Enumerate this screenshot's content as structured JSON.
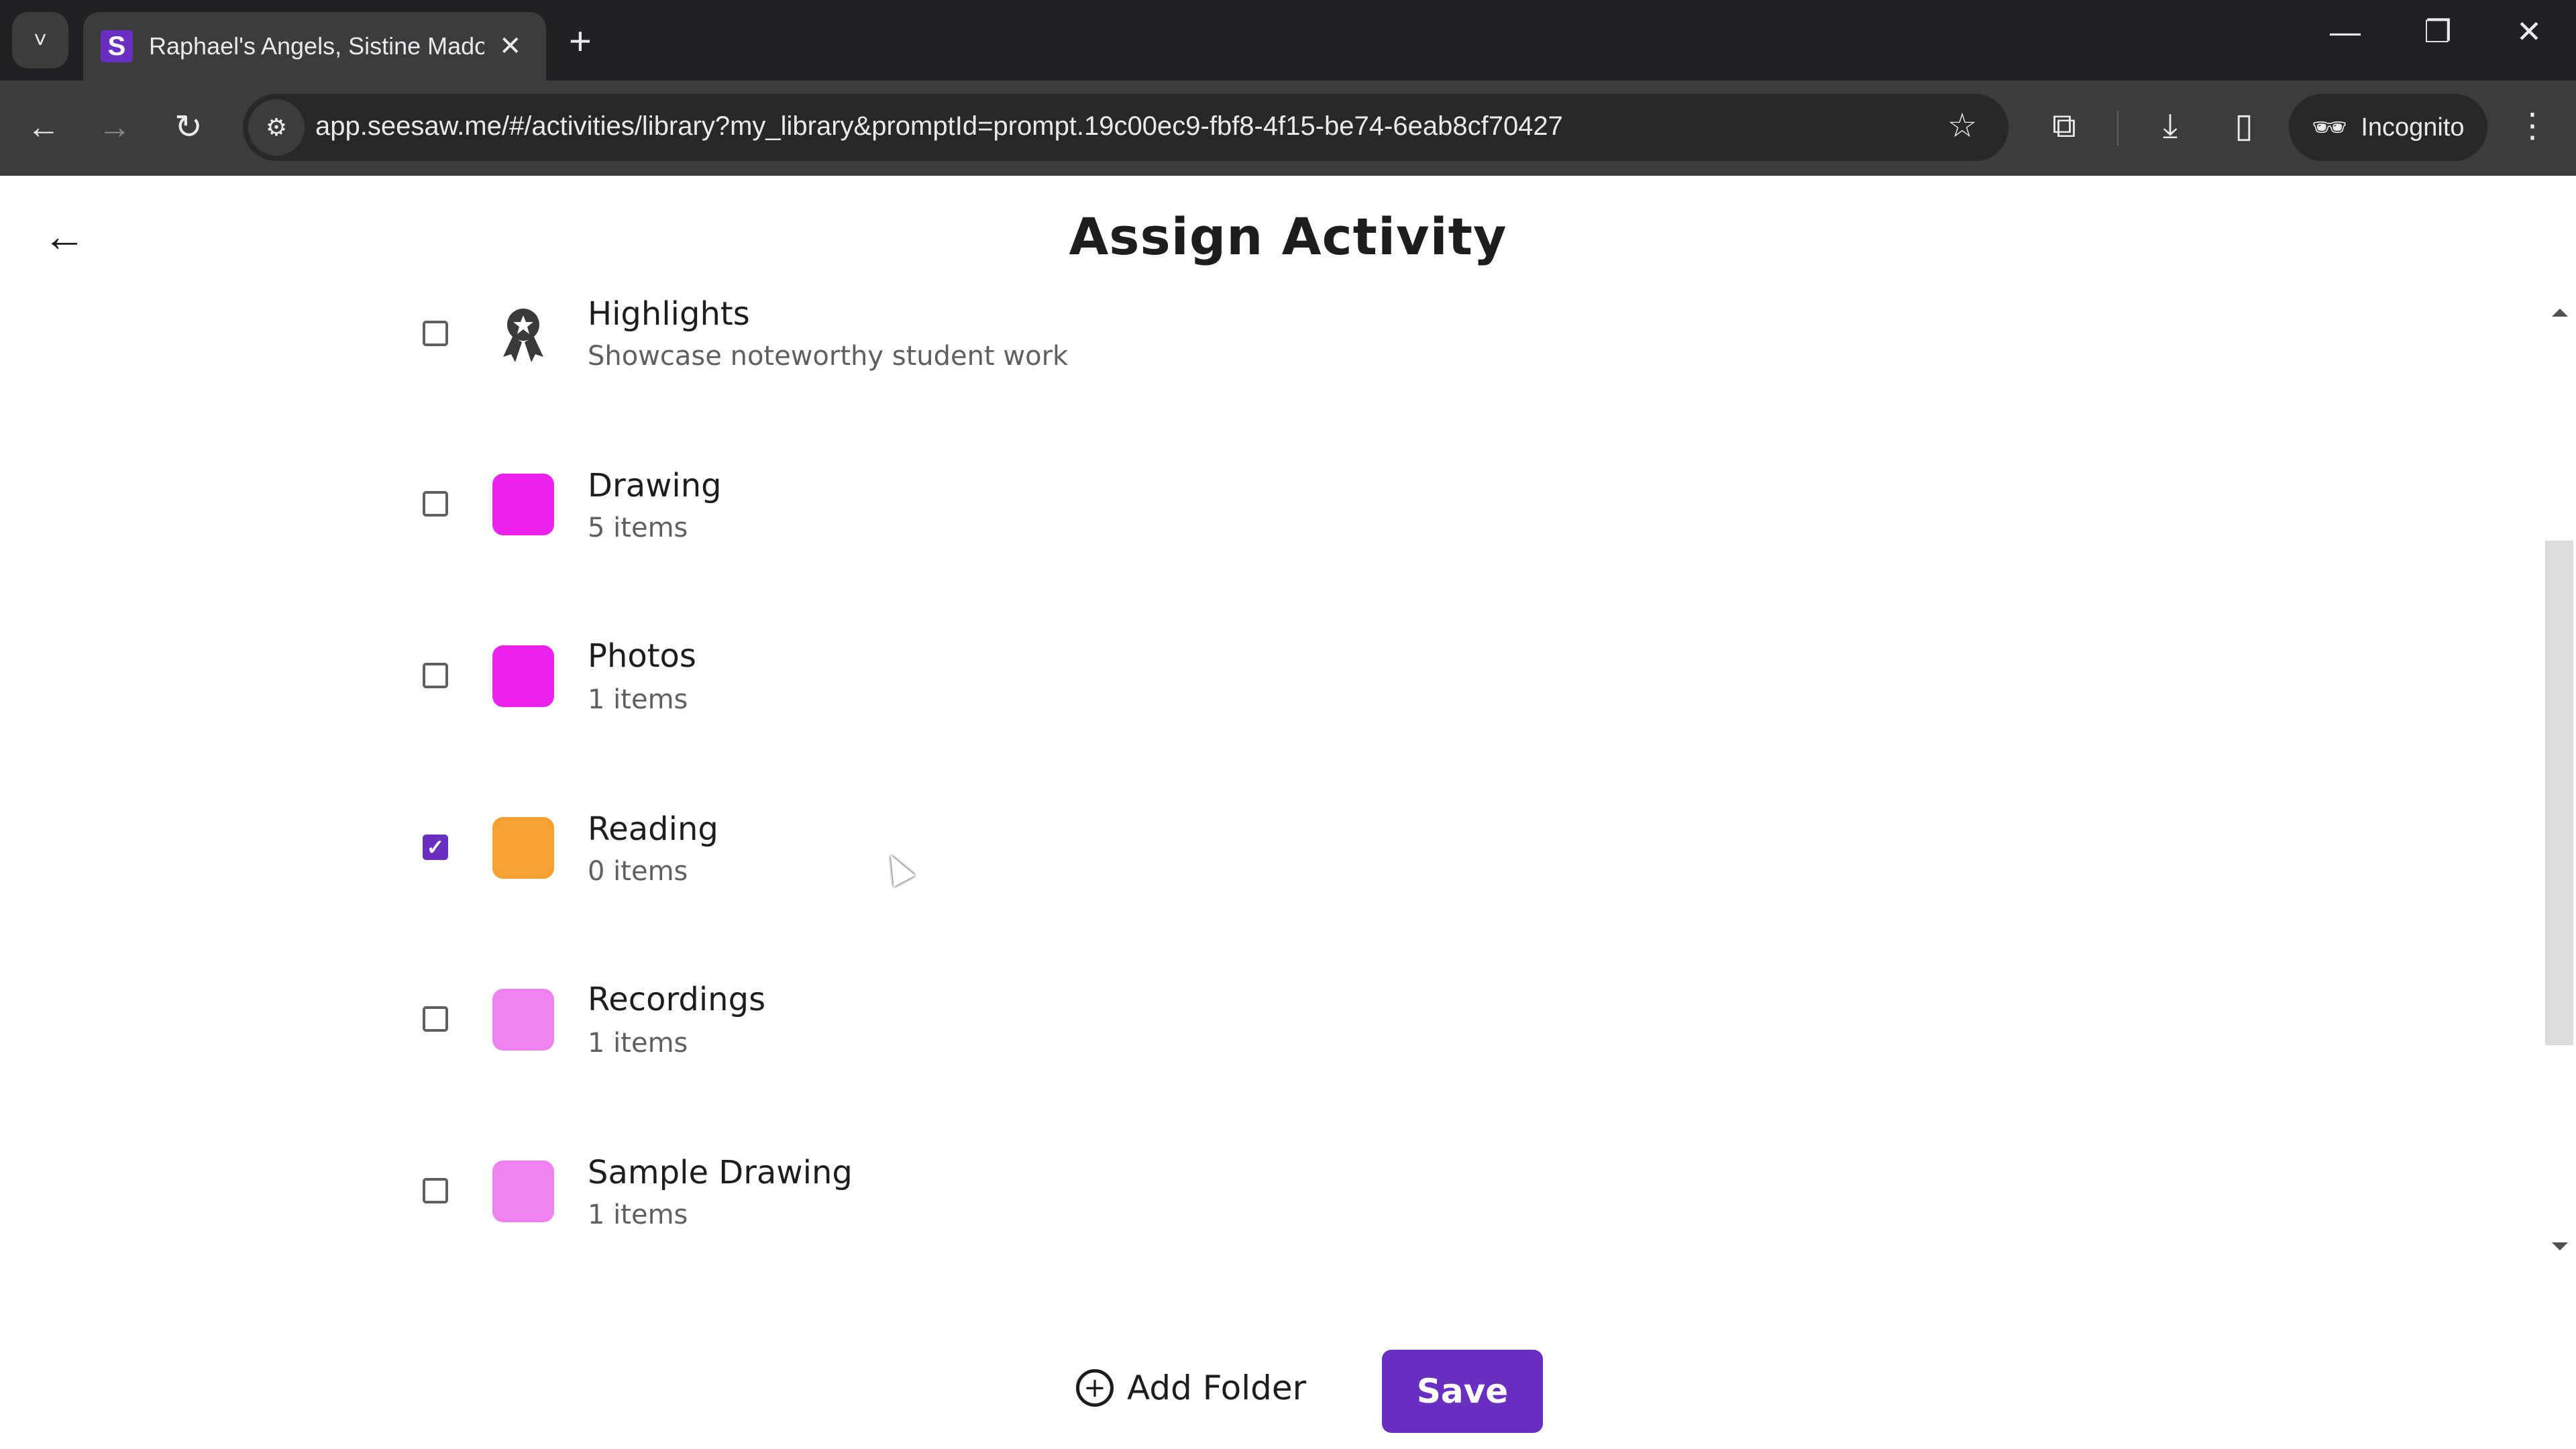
{
  "browser": {
    "tab_title": "Raphael's Angels, Sistine Madonna",
    "tab_favicon_letter": "S",
    "url": "app.seesaw.me/#/activities/library?my_library&promptId=prompt.19c00ec9-fbf8-4f15-be74-6eab8cf70427",
    "incognito_label": "Incognito",
    "icons": {
      "tab_search": "˅",
      "close_tab": "✕",
      "new_tab": "+",
      "minimize": "—",
      "restore": "❐",
      "close_window": "✕",
      "back": "←",
      "forward": "→",
      "reload": "↻",
      "site_info": "⚙",
      "bookmark": "☆",
      "extensions": "⧉",
      "download": "⤓",
      "side_panel": "▯",
      "incognito": "🕶",
      "menu": "⋮"
    }
  },
  "page": {
    "title": "Assign Activity",
    "back_icon": "←",
    "folders": [
      {
        "name": "Highlights",
        "subtitle": "Showcase noteworthy student work",
        "icon": "award-icon",
        "checked": false
      },
      {
        "name": "Drawing",
        "subtitle": "5 items",
        "color": "#ec22ec",
        "checked": false
      },
      {
        "name": "Photos",
        "subtitle": "1 items",
        "color": "#ec22ec",
        "checked": false
      },
      {
        "name": "Reading",
        "subtitle": "0 items",
        "color": "#f5a030",
        "checked": true
      },
      {
        "name": "Recordings",
        "subtitle": "1 items",
        "color": "#ee82ee",
        "checked": false
      },
      {
        "name": "Sample Drawing",
        "subtitle": "1 items",
        "color": "#ee82ee",
        "checked": false
      }
    ],
    "add_folder_label": "Add Folder",
    "add_folder_icon": "+",
    "save_label": "Save",
    "check_glyph": "✓"
  }
}
